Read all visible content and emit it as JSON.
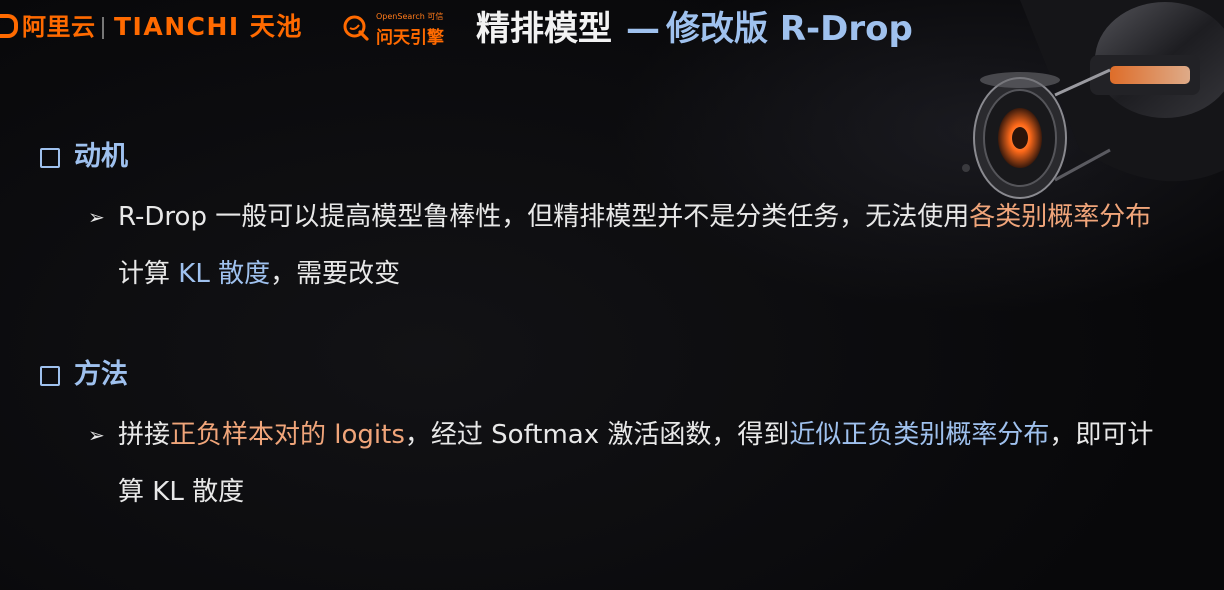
{
  "header": {
    "brand_aliyun": "阿里云",
    "brand_tianchi": "TIANCHI 天池",
    "opensearch_small": "OpenSearch 可信",
    "opensearch_main": "问天引擎",
    "title_main": "精排模型",
    "title_dash": "—",
    "title_sub": "修改版 R-Drop"
  },
  "sections": [
    {
      "title": "动机",
      "bullet": {
        "p1": "R-Drop 一般可以提高模型鲁棒性，但精排模型并不是分类任务，无法使用",
        "p2": "各类别概率分布",
        "p3": "计算 ",
        "p4": "KL 散度",
        "p5": "，需要改变"
      }
    },
    {
      "title": "方法",
      "bullet": {
        "p1": "拼接",
        "p2": "正负样本对的 logits",
        "p3": "，经过 Softmax 激活函数，得到",
        "p4": "近似正负类别概率分布",
        "p5": "，即可计算 KL 散度"
      }
    }
  ],
  "icons": {
    "bullet_marker": "arrow-right-icon",
    "section_marker": "checkbox-icon",
    "search_logo": "search-q-icon"
  },
  "colors": {
    "brand_orange": "#ff6a00",
    "accent_blue": "#9fc1ee",
    "highlight_orange": "#f0a57a",
    "text": "#e8e8e8",
    "background": "#0b0b0d"
  }
}
